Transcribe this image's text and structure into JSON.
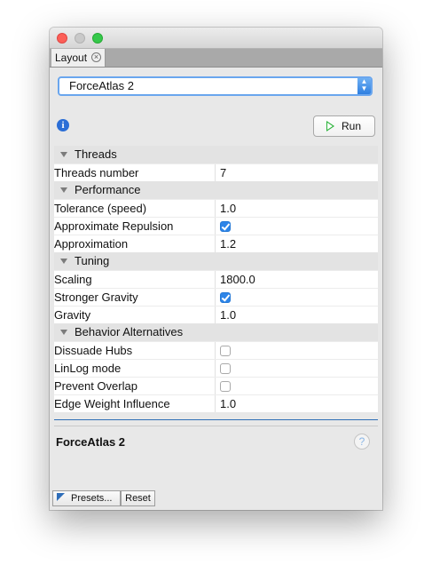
{
  "window": {
    "tab_label": "Layout",
    "tab_close_glyph": "×"
  },
  "layout_select": {
    "value": "ForceAtlas 2"
  },
  "toolbar": {
    "info_glyph": "i",
    "run_label": "Run"
  },
  "properties": [
    {
      "type": "category",
      "label": "Threads"
    },
    {
      "type": "property",
      "name": "Threads number",
      "value": "7"
    },
    {
      "type": "category",
      "label": "Performance"
    },
    {
      "type": "property",
      "name": "Tolerance (speed)",
      "value": "1.0"
    },
    {
      "type": "property",
      "name": "Approximate Repulsion",
      "checked": true
    },
    {
      "type": "property",
      "name": "Approximation",
      "value": "1.2"
    },
    {
      "type": "category",
      "label": "Tuning"
    },
    {
      "type": "property",
      "name": "Scaling",
      "value": "1800.0"
    },
    {
      "type": "property",
      "name": "Stronger Gravity",
      "checked": true
    },
    {
      "type": "property",
      "name": "Gravity",
      "value": "1.0"
    },
    {
      "type": "category",
      "label": "Behavior Alternatives"
    },
    {
      "type": "property",
      "name": "Dissuade Hubs",
      "checked": false
    },
    {
      "type": "property",
      "name": "LinLog mode",
      "checked": false
    },
    {
      "type": "property",
      "name": "Prevent Overlap",
      "checked": false
    },
    {
      "type": "property",
      "name": "Edge Weight Influence",
      "value": "1.0"
    }
  ],
  "description": {
    "title": "ForceAtlas 2",
    "help_glyph": "?"
  },
  "footer": {
    "presets_label": "Presets...",
    "reset_label": "Reset"
  },
  "colors": {
    "accent": "#2e85e8",
    "run_icon": "#2bb33a"
  }
}
